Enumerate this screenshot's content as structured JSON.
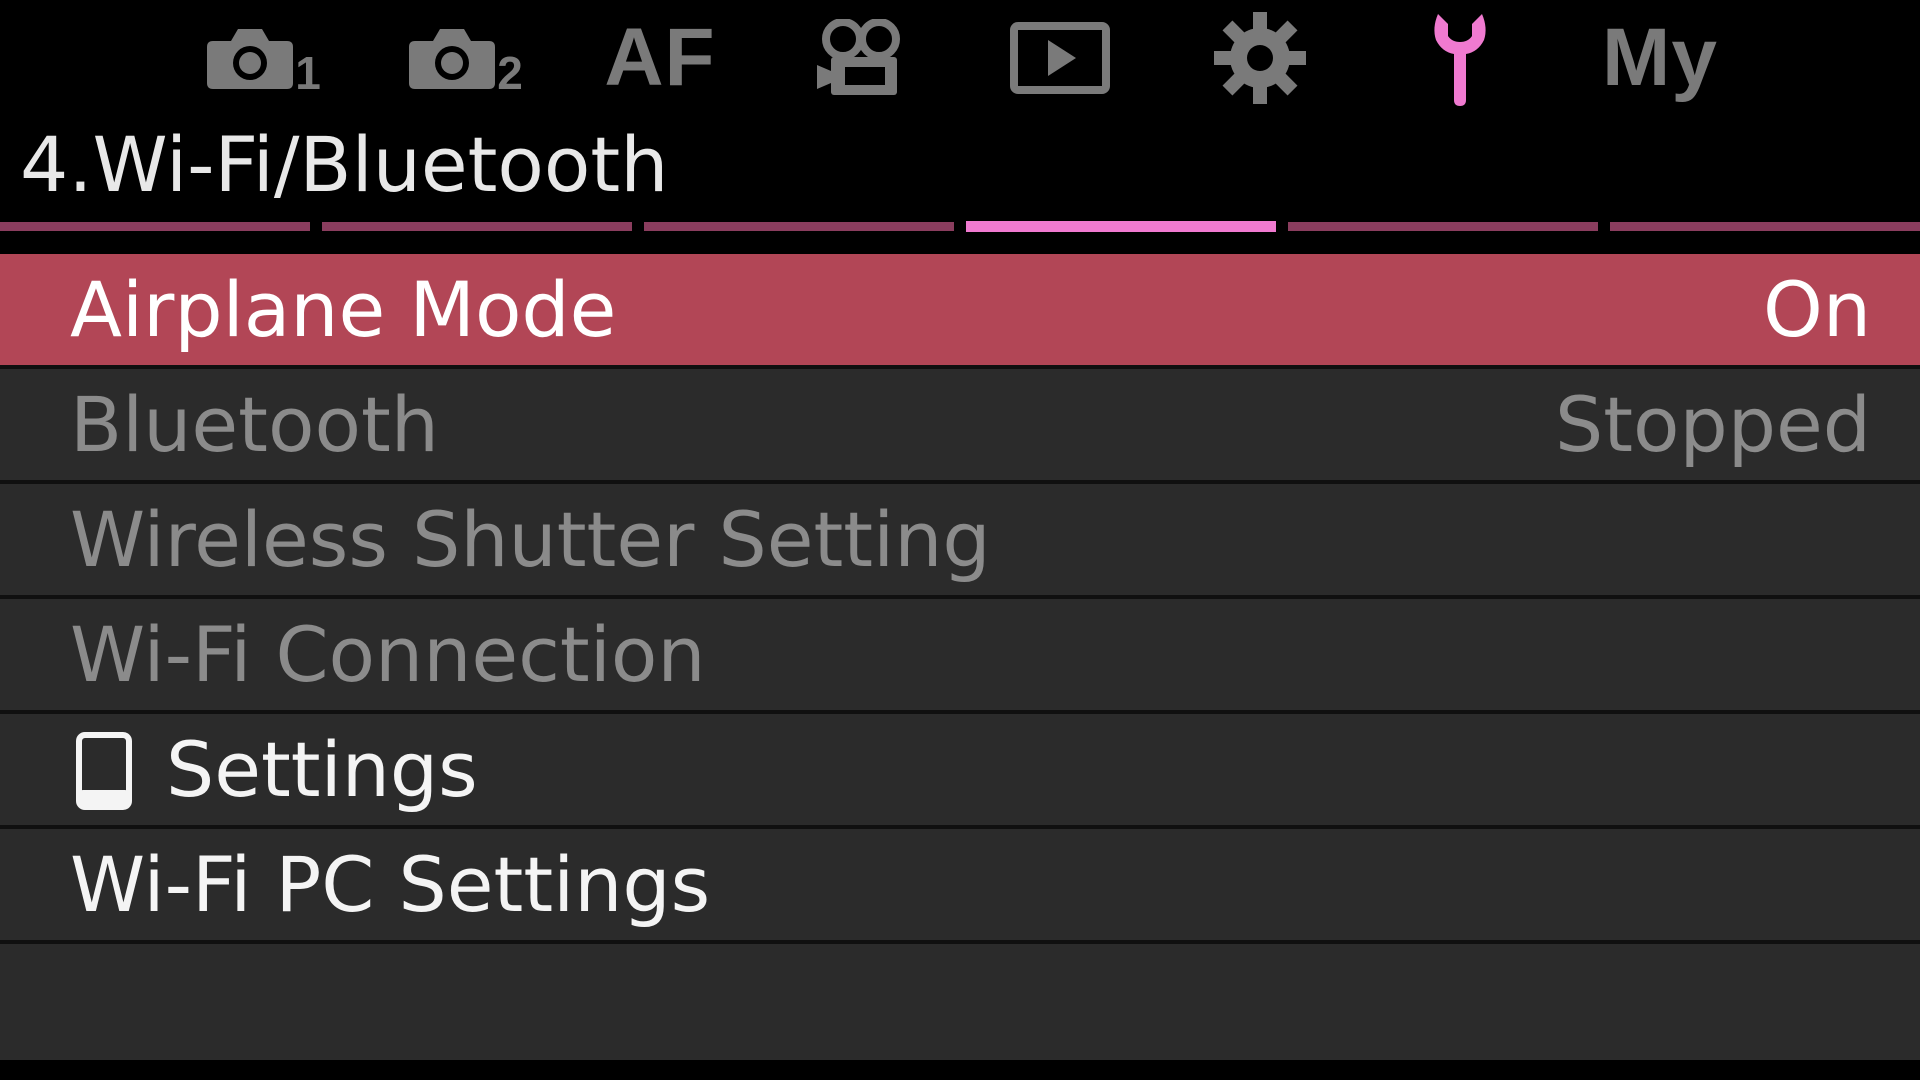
{
  "tabs": [
    {
      "id": "shooting-1",
      "icon": "camera-icon",
      "subscript": "1",
      "active": false
    },
    {
      "id": "shooting-2",
      "icon": "camera-icon",
      "subscript": "2",
      "active": false
    },
    {
      "id": "af",
      "text": "AF",
      "active": false
    },
    {
      "id": "video",
      "icon": "movie-camera-icon",
      "active": false
    },
    {
      "id": "playback",
      "icon": "playback-icon",
      "active": false
    },
    {
      "id": "custom",
      "icon": "gear-icon",
      "active": false
    },
    {
      "id": "setup",
      "icon": "wrench-icon",
      "active": true
    },
    {
      "id": "my-menu",
      "text": "My",
      "active": false
    }
  ],
  "page_title": "4.Wi-Fi/Bluetooth",
  "pages": {
    "total": 6,
    "current": 4
  },
  "colors": {
    "accent": "#f07ad0",
    "selection": "#b24656",
    "row_bg": "#2b2b2b",
    "inactive_tab": "#7a7a7a",
    "disabled_text": "#8b8b8b"
  },
  "menu": {
    "items": [
      {
        "label": "Airplane Mode",
        "value": "On",
        "state": "selected"
      },
      {
        "label": "Bluetooth",
        "value": "Stopped",
        "state": "disabled"
      },
      {
        "label": "Wireless Shutter Setting",
        "value": "",
        "state": "disabled"
      },
      {
        "label": "Wi-Fi Connection",
        "value": "",
        "state": "disabled"
      },
      {
        "label": "Settings",
        "value": "",
        "icon": "smartphone-icon",
        "state": "enabled"
      },
      {
        "label": "Wi-Fi PC Settings",
        "value": "",
        "state": "enabled"
      }
    ]
  }
}
